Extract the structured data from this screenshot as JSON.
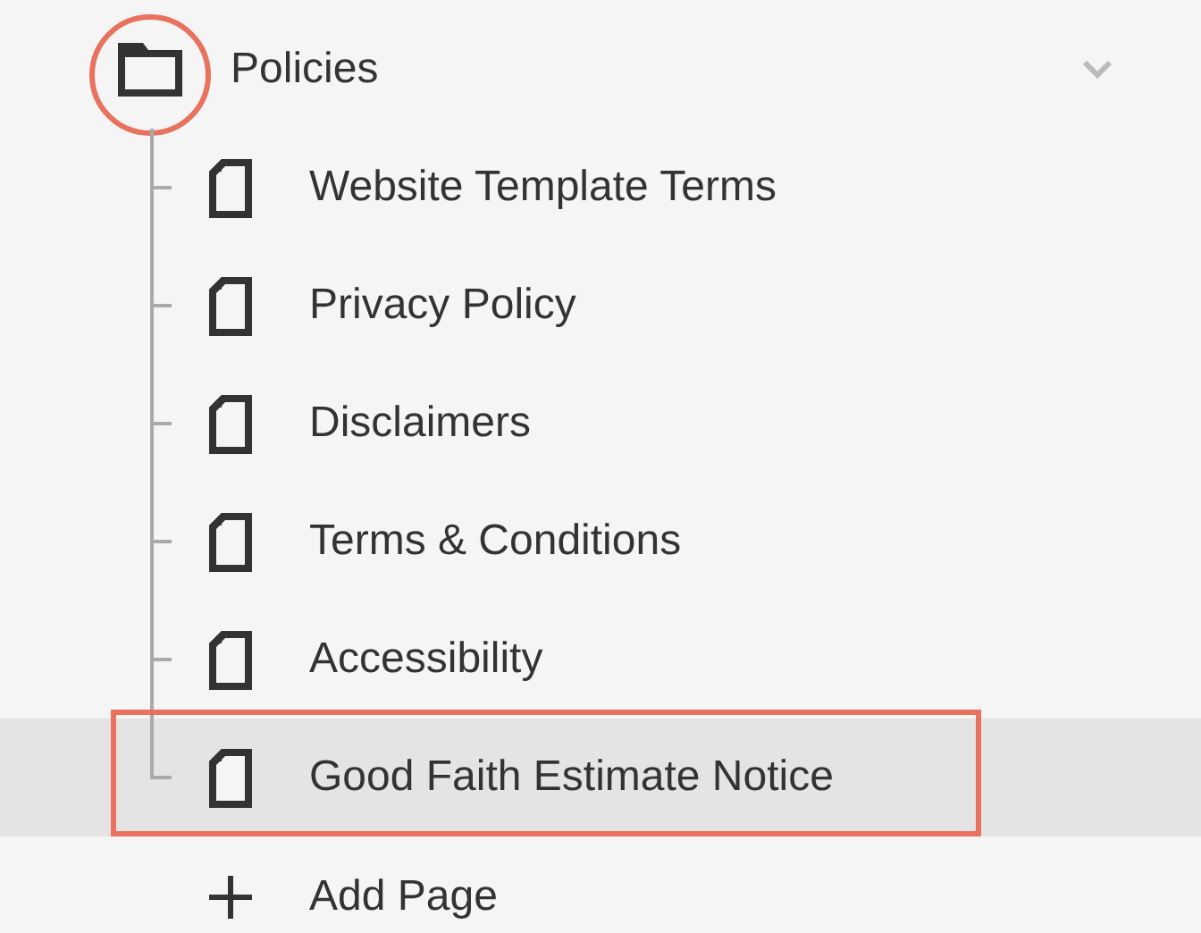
{
  "folder": {
    "label": "Policies",
    "expanded": true,
    "annotated": true,
    "children": [
      {
        "label": "Website Template Terms",
        "selected": false,
        "annotated": false
      },
      {
        "label": "Privacy Policy",
        "selected": false,
        "annotated": false
      },
      {
        "label": "Disclaimers",
        "selected": false,
        "annotated": false
      },
      {
        "label": "Terms & Conditions",
        "selected": false,
        "annotated": false
      },
      {
        "label": "Accessibility",
        "selected": false,
        "annotated": false
      },
      {
        "label": "Good Faith Estimate Notice",
        "selected": true,
        "annotated": true
      }
    ]
  },
  "add_button": {
    "label": "Add Page"
  }
}
